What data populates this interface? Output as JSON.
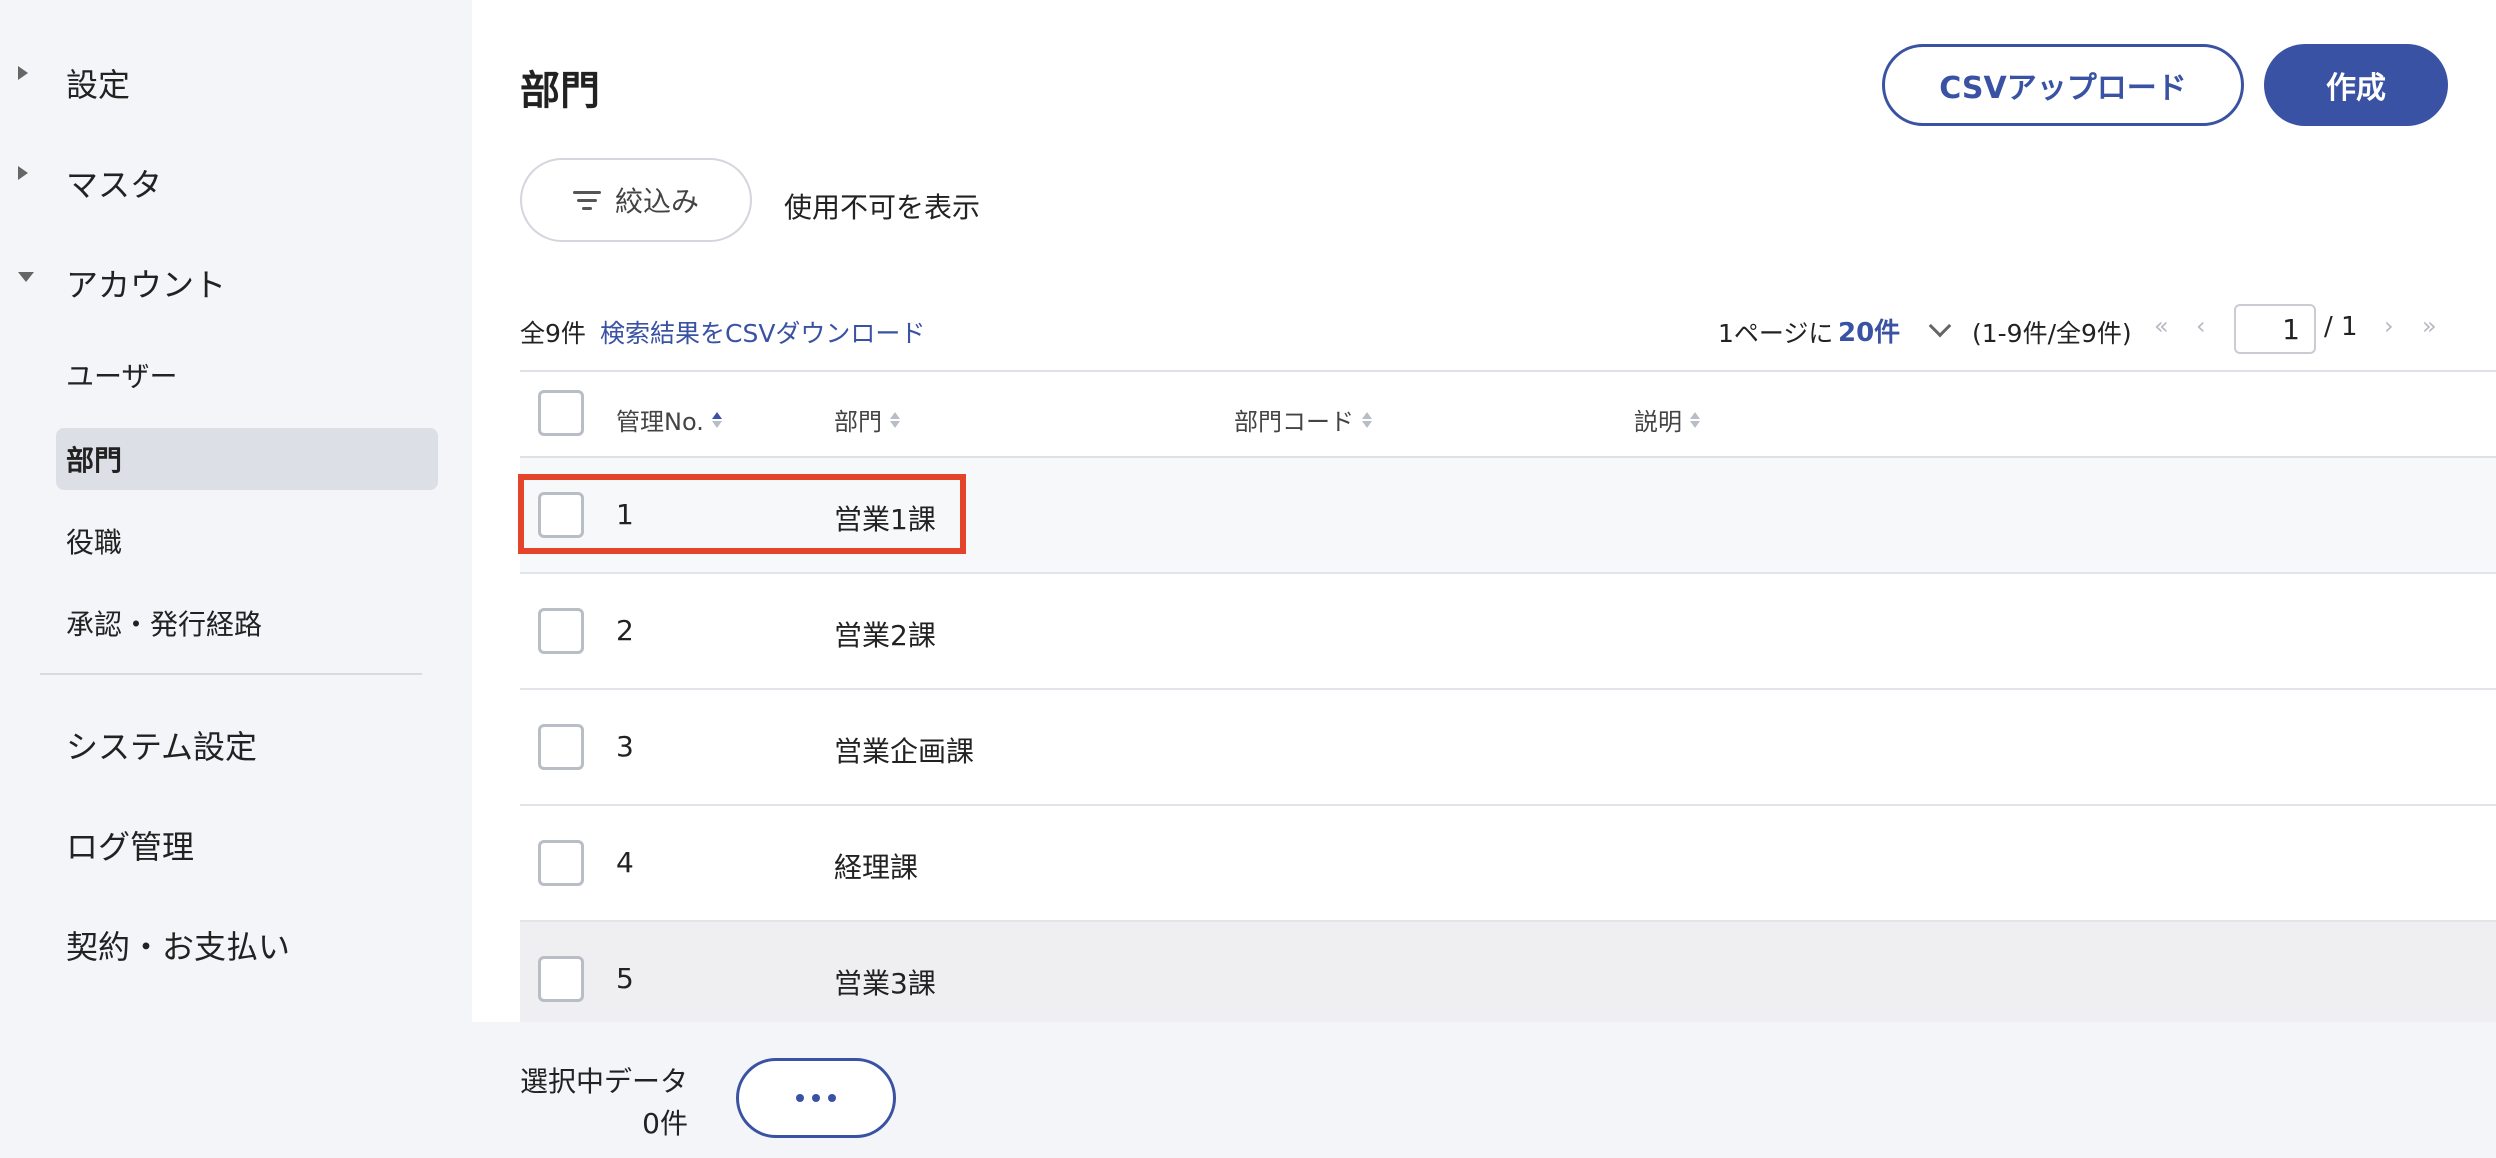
{
  "sidebar": {
    "sections": [
      {
        "label": "設定",
        "expanded": false
      },
      {
        "label": "マスタ",
        "expanded": false
      },
      {
        "label": "アカウント",
        "expanded": true
      }
    ],
    "account_items": [
      {
        "label": "ユーザー",
        "active": false
      },
      {
        "label": "部門",
        "active": true
      },
      {
        "label": "役職",
        "active": false
      },
      {
        "label": "承認・発行経路",
        "active": false
      }
    ],
    "main_items": [
      {
        "label": "システム設定"
      },
      {
        "label": "ログ管理"
      },
      {
        "label": "契約・お支払い"
      }
    ]
  },
  "header": {
    "title": "部門",
    "csv_upload_label": "CSVアップロード",
    "create_label": "作成"
  },
  "filters": {
    "filter_label": "絞込み",
    "show_disabled_label": "使用不可を表示"
  },
  "toolbar": {
    "total_count": "全9件",
    "csv_download_label": "検索結果をCSVダウンロード",
    "per_page_label": "1ページに",
    "per_page_value": "20件",
    "range_text": "(1-9件/全9件)",
    "current_page": "1",
    "total_pages": "/ 1",
    "first_glyph": "«",
    "prev_glyph": "‹",
    "next_glyph": "›",
    "last_glyph": "»"
  },
  "table": {
    "columns": [
      {
        "label": "管理No.",
        "sorted": "asc"
      },
      {
        "label": "部門",
        "sorted": "none"
      },
      {
        "label": "部門コード",
        "sorted": "none"
      },
      {
        "label": "説明",
        "sorted": "none"
      }
    ],
    "rows": [
      {
        "no": "1",
        "dept": "営業1課",
        "code": "",
        "desc": ""
      },
      {
        "no": "2",
        "dept": "営業2課",
        "code": "",
        "desc": ""
      },
      {
        "no": "3",
        "dept": "営業企画課",
        "code": "",
        "desc": ""
      },
      {
        "no": "4",
        "dept": "経理課",
        "code": "",
        "desc": ""
      },
      {
        "no": "5",
        "dept": "営業3課",
        "code": "",
        "desc": ""
      }
    ]
  },
  "footer": {
    "selected_label": "選択中データ",
    "selected_count": "0件"
  },
  "colors": {
    "accent": "#3a52a3",
    "highlight": "#e4442a",
    "sidebar_bg": "#f4f5f8"
  }
}
